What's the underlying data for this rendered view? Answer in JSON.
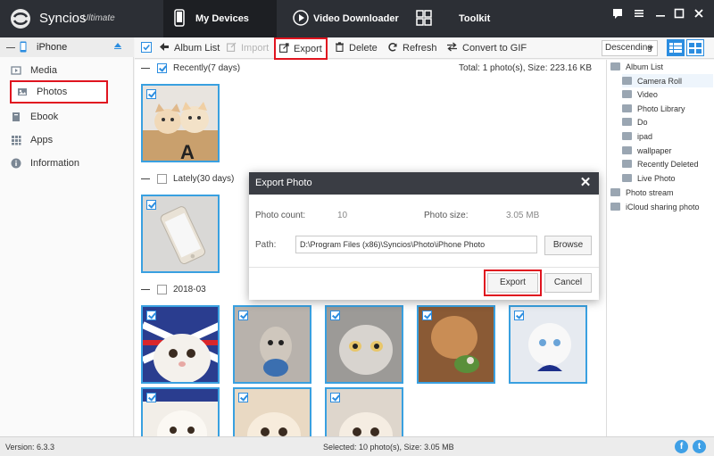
{
  "app": {
    "name": "Syncios",
    "edition": "Ultimate"
  },
  "nav": {
    "tabs": [
      {
        "label": "My Devices"
      },
      {
        "label": "Video Downloader"
      },
      {
        "label": "Toolkit"
      }
    ]
  },
  "sidebar": {
    "device": "iPhone",
    "items": [
      {
        "label": "Media",
        "icon": "media-icon"
      },
      {
        "label": "Photos",
        "icon": "photos-icon"
      },
      {
        "label": "Ebook",
        "icon": "ebook-icon"
      },
      {
        "label": "Apps",
        "icon": "apps-icon"
      },
      {
        "label": "Information",
        "icon": "information-icon"
      }
    ]
  },
  "toolbar": {
    "album_list": "Album List",
    "import": "Import",
    "export": "Export",
    "delete": "Delete",
    "refresh": "Refresh",
    "convert": "Convert to GIF",
    "sort": "Descending"
  },
  "groups": [
    {
      "label": "Recently(7 days)",
      "summary": "Total: 1 photo(s), Size: 223.16 KB"
    },
    {
      "label": "Lately(30 days)"
    },
    {
      "label": "2018-03"
    }
  ],
  "albums": [
    {
      "label": "Album List"
    },
    {
      "label": "Camera Roll"
    },
    {
      "label": "Video"
    },
    {
      "label": "Photo Library"
    },
    {
      "label": "Do"
    },
    {
      "label": "ipad"
    },
    {
      "label": "wallpaper"
    },
    {
      "label": "Recently Deleted"
    },
    {
      "label": "Live Photo"
    },
    {
      "label": "Photo stream"
    },
    {
      "label": "iCloud sharing photo"
    }
  ],
  "dialog": {
    "title": "Export Photo",
    "count_label": "Photo count:",
    "count_value": "10",
    "size_label": "Photo size:",
    "size_value": "3.05 MB",
    "path_label": "Path:",
    "path_value": "D:\\Program Files (x86)\\Syncios\\Photo\\iPhone Photo",
    "browse": "Browse",
    "export": "Export",
    "cancel": "Cancel"
  },
  "status": {
    "version": "Version: 6.3.3",
    "selected": "Selected: 10 photo(s), Size: 3.05 MB",
    "social": {
      "facebook": "f",
      "twitter": "t"
    }
  },
  "colors": {
    "accent": "#2b8de0",
    "highlight": "#e0141f",
    "titlebar": "#2c2f35"
  }
}
